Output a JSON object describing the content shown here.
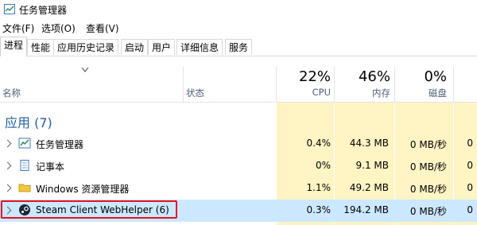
{
  "window": {
    "title": "任务管理器"
  },
  "menu": [
    "文件(F)",
    "选项(O)",
    "查看(V)"
  ],
  "tabs": [
    "进程",
    "性能",
    "应用历史记录",
    "启动",
    "用户",
    "详细信息",
    "服务"
  ],
  "header": {
    "name_label": "名称",
    "status_label": "状态",
    "cpu_pct": "22%",
    "cpu_label": "CPU",
    "mem_pct": "46%",
    "mem_label": "内存",
    "disk_pct": "0%",
    "disk_label": "磁盘"
  },
  "group": {
    "title": "应用 (7)"
  },
  "rows": [
    {
      "name": "任务管理器",
      "icon": "task-manager-icon",
      "cpu": "0.4%",
      "mem": "44.3 MB",
      "disk": "0 MB/秒",
      "net": "0"
    },
    {
      "name": "记事本",
      "icon": "notepad-icon",
      "cpu": "0%",
      "mem": "9.1 MB",
      "disk": "0 MB/秒",
      "net": "0"
    },
    {
      "name": "Windows 资源管理器",
      "icon": "folder-icon",
      "cpu": "1.1%",
      "mem": "49.2 MB",
      "disk": "0 MB/秒",
      "net": "0"
    },
    {
      "name": "Steam Client WebHelper (6)",
      "icon": "steam-icon",
      "cpu": "0.3%",
      "mem": "194.2 MB",
      "disk": "0 MB/秒",
      "net": "0"
    }
  ],
  "colors": {
    "heat": "#fff4c4",
    "selected": "#cce8ff",
    "highlight_box": "#e81123",
    "group_title": "#1f5fa8"
  }
}
